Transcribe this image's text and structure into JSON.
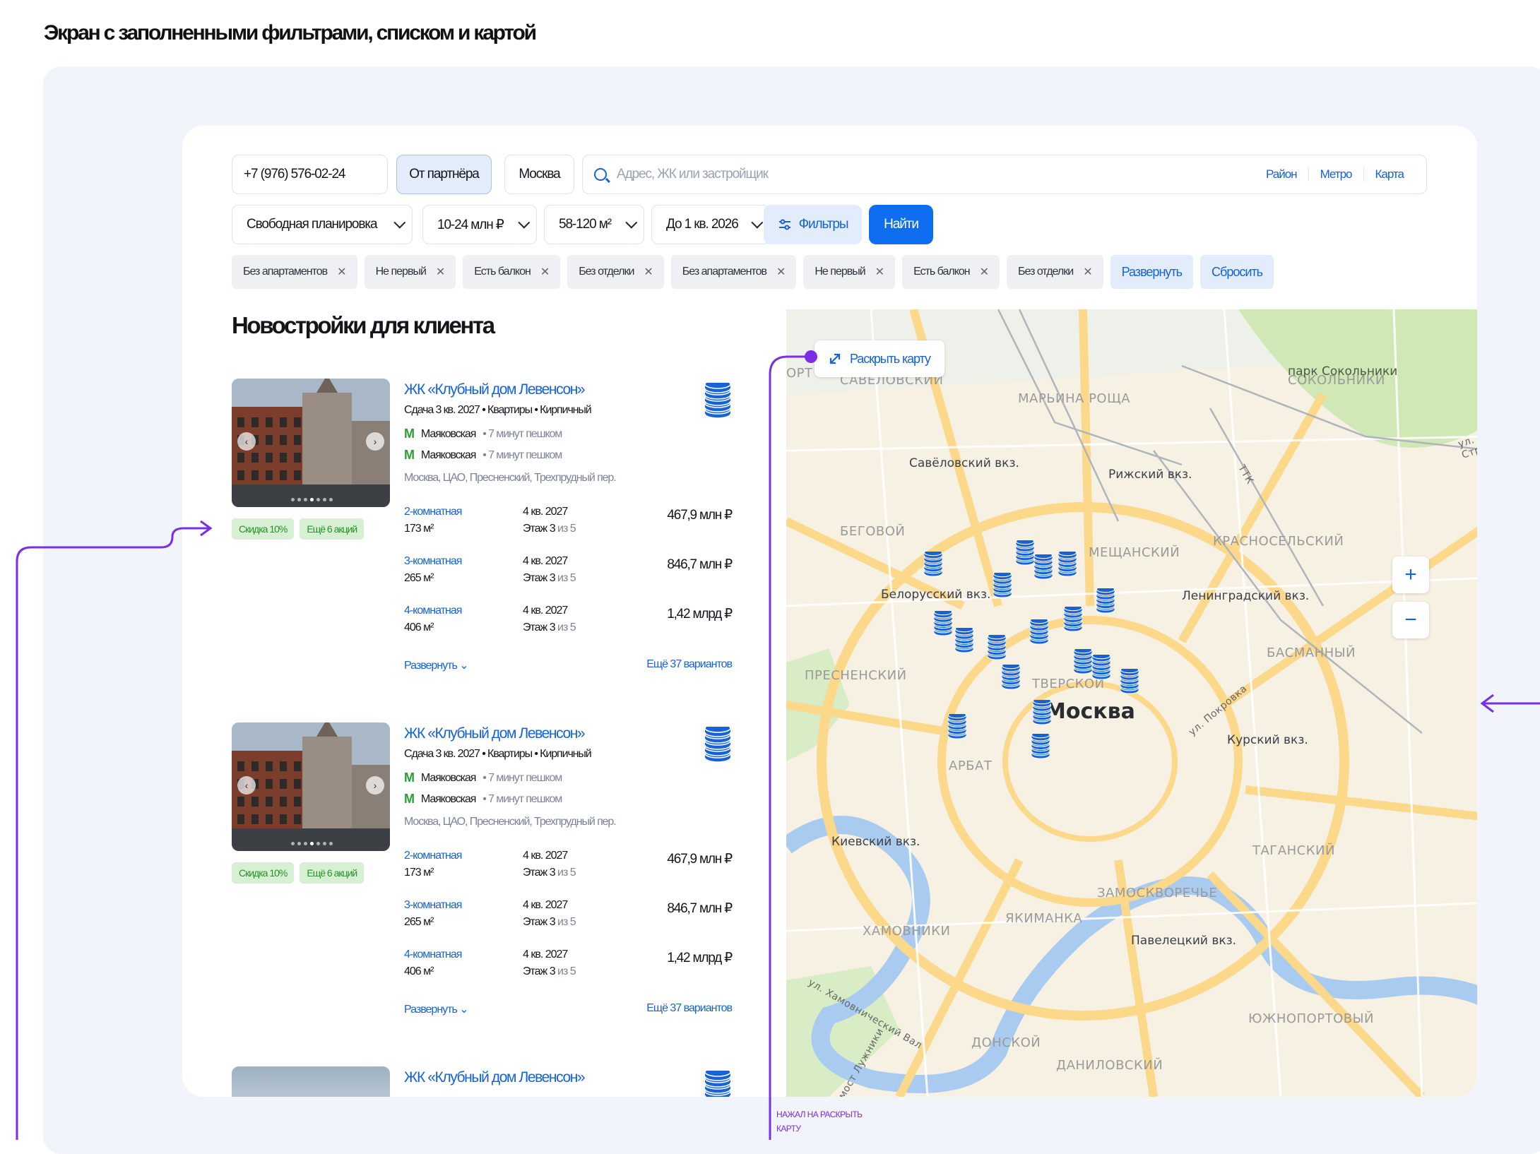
{
  "page_title": "Экран с заполненными фильтрами, списком и картой",
  "search": {
    "phone": "+7 (976) 576-02-24",
    "partner_button": "От партнёра",
    "city": "Москва",
    "placeholder": "Адрес, ЖК или застройщик",
    "links": [
      "Район",
      "Метро",
      "Карта"
    ]
  },
  "filters": {
    "layout": "Свободная планировка",
    "price": "10-24 млн ₽",
    "area": "58-120 м²",
    "deadline": "До 1 кв. 2026",
    "filters_button": "Фильтры",
    "find_button": "Найти"
  },
  "chips": [
    "Без апартаментов",
    "Не первый",
    "Есть балкон",
    "Без отделки",
    "Без апартаментов",
    "Не первый",
    "Есть балкон",
    "Без отделки"
  ],
  "chip_actions": {
    "expand": "Развернуть",
    "reset": "Сбросить"
  },
  "list_title": "Новостройки для клиента",
  "cards": [
    {
      "title": "ЖК «Клубный дом Левенсон»",
      "subtitle": "Сдача 3 кв. 2027 • Квартиры • Кирпичный",
      "metro": [
        {
          "station": "Маяковская",
          "time": "• 7 минут пешком"
        },
        {
          "station": "Маяковская",
          "time": "• 7 минут пешком"
        }
      ],
      "address": "Москва, ЦАО, Пресненский, Трехпрудный пер.",
      "badges": [
        "Скидка 10%",
        "Ещё 6 акций"
      ],
      "flats": [
        {
          "type": "2-комнатная",
          "area": "173 м²",
          "date": "4 кв. 2027",
          "floor": "Этаж 3",
          "floor_of": " из 5",
          "price": "467,9 млн ₽"
        },
        {
          "type": "3-комнатная",
          "area": "265 м²",
          "date": "4 кв. 2027",
          "floor": "Этаж 3",
          "floor_of": " из 5",
          "price": "846,7 млн ₽"
        },
        {
          "type": "4-комнатная",
          "area": "406 м²",
          "date": "4 кв. 2027",
          "floor": "Этаж 3",
          "floor_of": " из 5",
          "price": "1,42 млрд ₽"
        }
      ],
      "expand": "Развернуть",
      "more": "Ещё 37 вариантов"
    },
    {
      "title": "ЖК «Клубный дом Левенсон»",
      "subtitle": "Сдача 3 кв. 2027 • Квартиры • Кирпичный",
      "metro": [
        {
          "station": "Маяковская",
          "time": "• 7 минут пешком"
        },
        {
          "station": "Маяковская",
          "time": "• 7 минут пешком"
        }
      ],
      "address": "Москва, ЦАО, Пресненский, Трехпрудный пер.",
      "badges": [
        "Скидка 10%",
        "Ещё 6 акций"
      ],
      "flats": [
        {
          "type": "2-комнатная",
          "area": "173 м²",
          "date": "4 кв. 2027",
          "floor": "Этаж 3",
          "floor_of": " из 5",
          "price": "467,9 млн ₽"
        },
        {
          "type": "3-комнатная",
          "area": "265 м²",
          "date": "4 кв. 2027",
          "floor": "Этаж 3",
          "floor_of": " из 5",
          "price": "846,7 млн ₽"
        },
        {
          "type": "4-комнатная",
          "area": "406 м²",
          "date": "4 кв. 2027",
          "floor": "Этаж 3",
          "floor_of": " из 5",
          "price": "1,42 млрд ₽"
        }
      ],
      "expand": "Развернуть",
      "more": "Ещё 37 вариантов"
    },
    {
      "title": "ЖК «Клубный дом Левенсон»"
    }
  ],
  "map": {
    "open_button": "Раскрыть карту",
    "city": "Москва",
    "districts": [
      "ОРТ",
      "САВЁЛОВСКИЙ",
      "МАРЬИНА РОЩА",
      "СОКОЛЬНИКИ",
      "БЕГОВОЙ",
      "МЕЩАНСКИЙ",
      "КРАСНОСЕЛЬСКИЙ",
      "ПРЕСНЕНСКИЙ",
      "ТВЕРСКОЙ",
      "БАСМАННЫЙ",
      "АРБАТ",
      "ТАГАНСКИЙ",
      "ЗАМОСКВОРЕЧЬЕ",
      "ХАМОВНИКИ",
      "ЯКИМАНКА",
      "ДОНСКОЙ",
      "ДАНИЛОВСКИЙ",
      "ЮЖНОПОРТОВЫЙ"
    ],
    "stations": [
      "Савёловский вкз.",
      "Рижский вкз.",
      "Белорусский вкз.",
      "Ленинградский вкз.",
      "Курский вкз.",
      "Киевский вкз.",
      "Павелецкий вкз."
    ],
    "park": "парк Сокольники",
    "roads": [
      "ул. Стромынка",
      "ТТК",
      "ул. Покровка",
      "ул. Хамовнический Вал",
      "мост Лужники"
    ],
    "zoom_in": "+",
    "zoom_out": "−"
  },
  "annotation": "НАЖАЛ НА РАСКРЫТЬ КАРТУ",
  "colors": {
    "accent": "#1662d8",
    "button": "#0f6ef0",
    "annotation": "#7a2ee6",
    "badge_bg": "#d7f0d3",
    "badge_text": "#27912a"
  }
}
